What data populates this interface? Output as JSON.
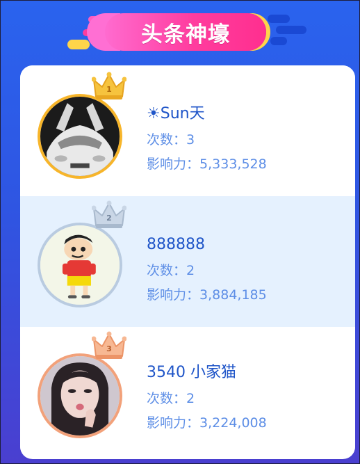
{
  "header": {
    "title": "头条神壕"
  },
  "ranking": [
    {
      "rank": "1",
      "name": "☀Sun天",
      "times_label": "次数：",
      "times": "3",
      "influence_label": "影响力：",
      "influence": "5,333,528"
    },
    {
      "rank": "2",
      "name": "888888",
      "times_label": "次数：",
      "times": "2",
      "influence_label": "影响力：",
      "influence": "3,884,185"
    },
    {
      "rank": "3",
      "name": "3540 小家猫",
      "times_label": "次数：",
      "times": "2",
      "influence_label": "影响力：",
      "influence": "3,224,008"
    }
  ],
  "colors": {
    "frame_top": "#2a63ee",
    "frame_bottom": "#4a3fd0",
    "title_pill": "#ff3c9e",
    "pill_accent": "#ffd54a",
    "name_text": "#1f55c8",
    "stat_text": "#5d8ee6",
    "row_highlight": "#e5f1fe",
    "rank1_border": "#f7b52a",
    "rank2_border": "#b9cbe0",
    "rank3_border": "#f2a17a"
  },
  "icons": {
    "rank1": "gold-crown-icon",
    "rank2": "silver-crown-icon",
    "rank3": "bronze-crown-icon"
  }
}
